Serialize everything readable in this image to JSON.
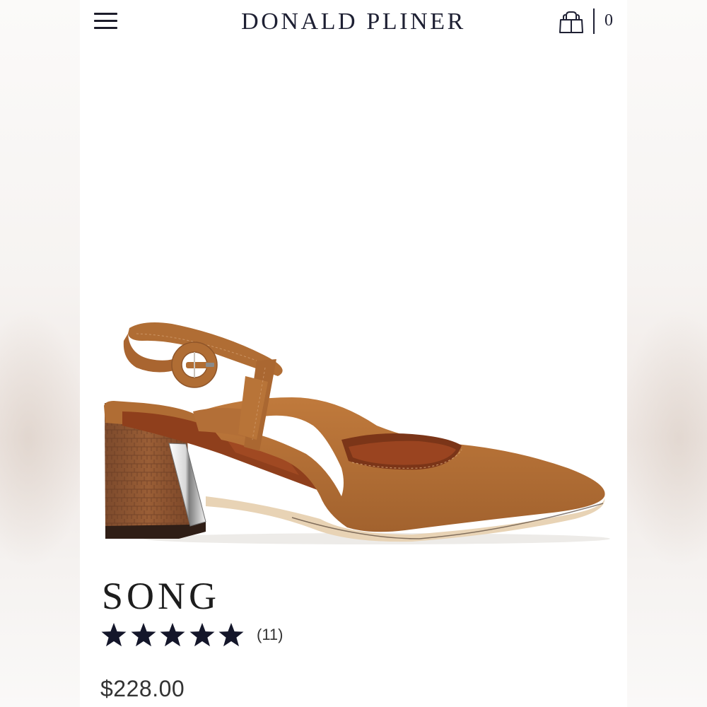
{
  "header": {
    "brand": "DONALD PLINER",
    "menu_icon": "hamburger-menu-icon",
    "cart_icon": "shopping-bag-icon",
    "cart_count": "0"
  },
  "product": {
    "name": "SONG",
    "rating": 5,
    "rating_max": 5,
    "review_count": "(11)",
    "price": "$228.00",
    "image_alt": "Cognac suede slingback block-heel pump",
    "colors": {
      "suede": "#b06d34",
      "heel": "#8a5231",
      "lining": "#9c4a24"
    }
  },
  "colors": {
    "text_dark": "#1e2033",
    "star": "#14162a"
  }
}
